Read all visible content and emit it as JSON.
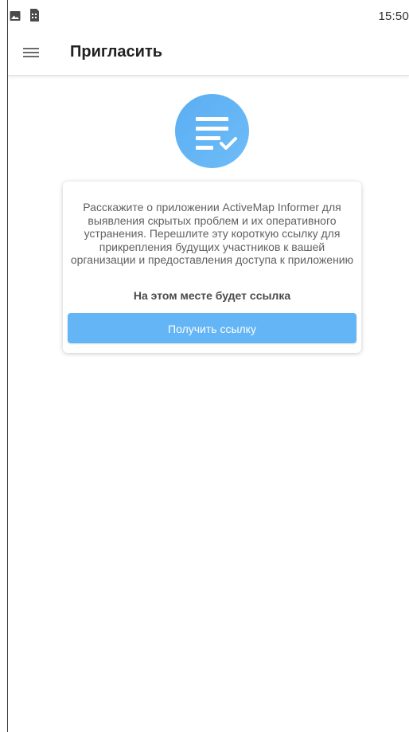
{
  "status_bar": {
    "time": "15:50",
    "icons": [
      "image-icon",
      "sim-card-icon"
    ]
  },
  "app_bar": {
    "menu_icon": "hamburger-menu-icon",
    "title": "Пригласить"
  },
  "hero": {
    "icon": "checklist-icon",
    "color": "#64b5f6"
  },
  "card": {
    "description": "Расскажите о приложении ActiveMap Informer для выявления скрытых проблем и их оперативного устранения. Перешлите эту короткую ссылку для прикрепления будущих участников к вашей организации и предоставления доступа к приложению",
    "link_placeholder": "На этом месте будет ссылка",
    "button_label": "Получить ссылку",
    "button_color": "#64b5f6"
  }
}
